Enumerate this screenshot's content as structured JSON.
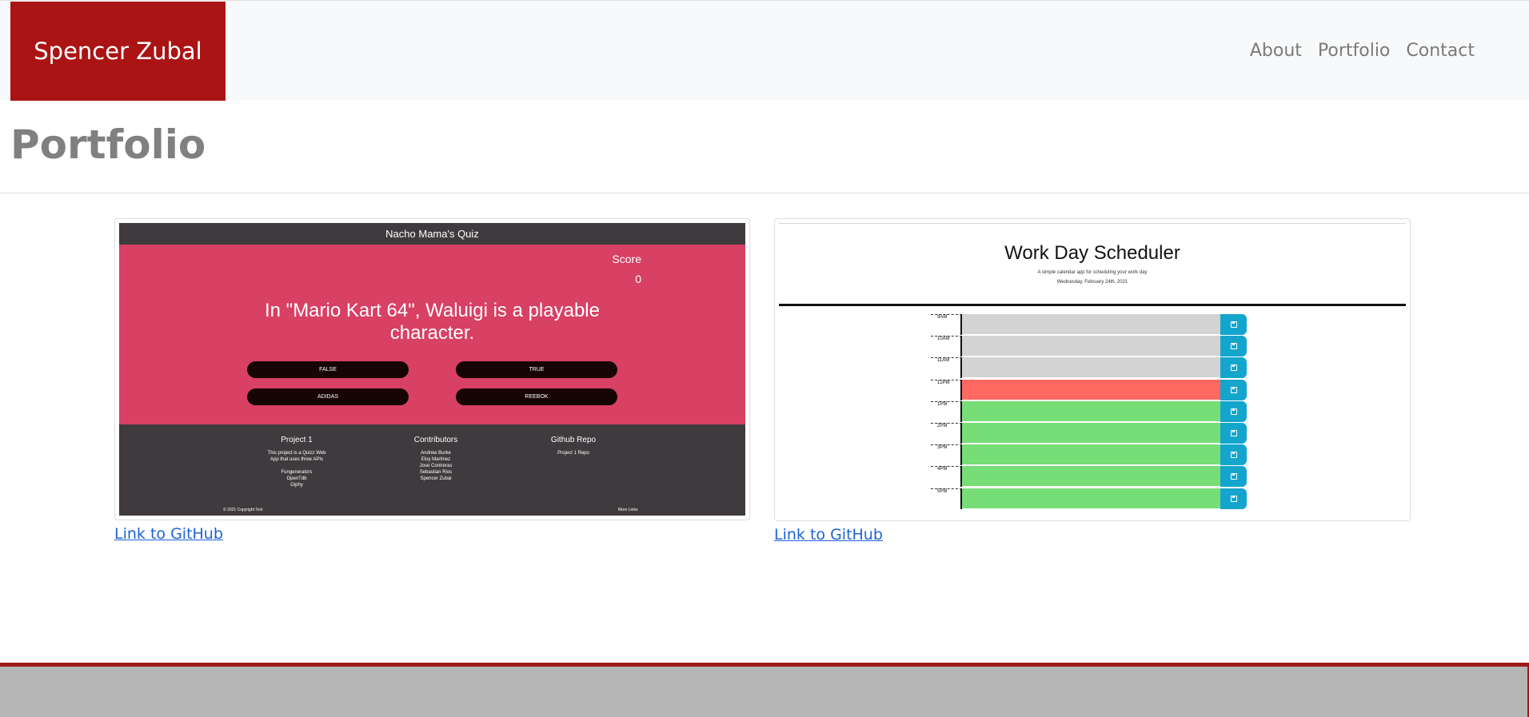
{
  "navbar": {
    "brand": "Spencer Zubal",
    "links": [
      "About",
      "Portfolio",
      "Contact"
    ]
  },
  "page": {
    "title": "Portfolio"
  },
  "projects": [
    {
      "link_label": "Link to GitHub",
      "preview": {
        "header": "Nacho Mama's Quiz",
        "score_label": "Score",
        "score": "0",
        "question": "In \"Mario Kart 64\", Waluigi is a playable character.",
        "answers": [
          "FALSE",
          "TRUE",
          "ADIDAS",
          "REEBOK"
        ],
        "footer": {
          "col1_title": "Project 1",
          "col1_lines": [
            "This project is a Quizz Web",
            "App that uses three APIs",
            "",
            "Fungenerators",
            "OpenTdb",
            "Giphy"
          ],
          "col2_title": "Contributors",
          "col2_lines": [
            "Andrew Burke",
            "Eloy Martinez",
            "Jose Contreras",
            "Sebastian Rios",
            "Spencer Zubal"
          ],
          "col3_title": "Github Repo",
          "col3_lines": [
            "Project 1 Repo"
          ],
          "copyright": "© 2021 Copyright Text",
          "more": "More Links"
        },
        "colors": {
          "body": "#d84064",
          "bar": "#3f3a3d",
          "button": "#170505"
        }
      }
    },
    {
      "link_label": "Link to GitHub",
      "preview": {
        "title": "Work Day Scheduler",
        "subtitle": "A simple calendar app for scheduling your work day",
        "date": "Wednesday, February 24th, 2021",
        "hours": [
          {
            "label": "9AM",
            "state": "past"
          },
          {
            "label": "10AM",
            "state": "past"
          },
          {
            "label": "11AM",
            "state": "past"
          },
          {
            "label": "12PM",
            "state": "present"
          },
          {
            "label": "1PM",
            "state": "future"
          },
          {
            "label": "2PM",
            "state": "future"
          },
          {
            "label": "3PM",
            "state": "future"
          },
          {
            "label": "4PM",
            "state": "future"
          },
          {
            "label": "5PM",
            "state": "future"
          }
        ],
        "colors": {
          "past": "#d3d3d3",
          "present": "#ff6961",
          "future": "#77dd77",
          "save": "#14a5cd"
        },
        "save_icon": "floppy-disk-icon"
      }
    }
  ],
  "colors": {
    "brand_bg": "#ab1414",
    "link": "#1e63d6",
    "footer_bg": "#b5b5b5",
    "footer_border": "#9e1a1a"
  }
}
